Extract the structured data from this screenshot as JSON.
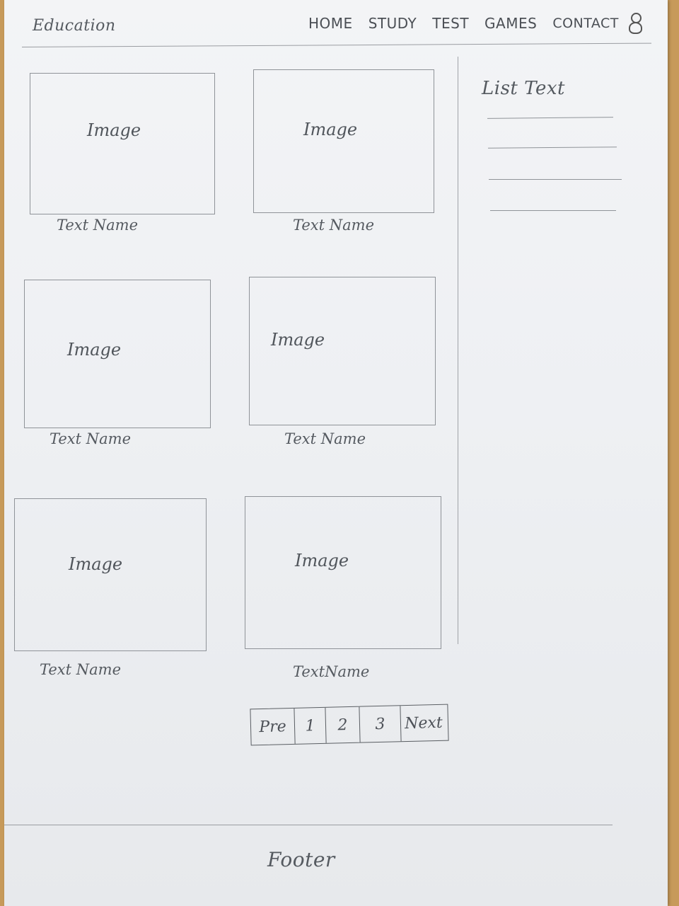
{
  "header": {
    "brand": "Education",
    "nav": [
      "HOME",
      "STUDY",
      "TEST",
      "GAMES",
      "CONTACT"
    ],
    "user_icon": "user-icon"
  },
  "cards": [
    {
      "image_label": "Image",
      "name": "Text Name"
    },
    {
      "image_label": "Image",
      "name": "Text Name"
    },
    {
      "image_label": "Image",
      "name": "Text Name"
    },
    {
      "image_label": "Image",
      "name": "Text Name"
    },
    {
      "image_label": "Image",
      "name": "TextName"
    },
    {
      "image_label": "Image",
      "name": "Text Name"
    }
  ],
  "sidebar": {
    "title": "List Text",
    "item_count_note": ""
  },
  "pagination": [
    "Pre",
    "1",
    "2",
    "3",
    "Next"
  ],
  "footer": {
    "text": "Footer"
  }
}
